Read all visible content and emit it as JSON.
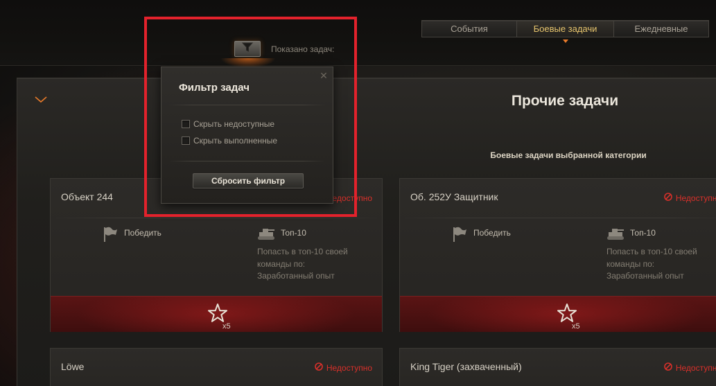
{
  "tabs": [
    {
      "label": "События",
      "active": false
    },
    {
      "label": "Боевые задачи",
      "active": true
    },
    {
      "label": "Ежедневные",
      "active": false
    }
  ],
  "filter_bar": {
    "toggle_icon": "funnel-icon",
    "shown_label": "Показано задач:"
  },
  "section": {
    "title": "Прочие задачи",
    "caption": "Боевые задачи выбранной категории"
  },
  "popup": {
    "title": "Фильтр задач",
    "options": [
      {
        "label": "Скрыть недоступные",
        "checked": false
      },
      {
        "label": "Скрыть выполненные",
        "checked": false
      }
    ],
    "reset_label": "Сбросить фильтр"
  },
  "cards": [
    {
      "title": "Объект 244",
      "status": "Недоступно",
      "condition1": {
        "label": "Победить",
        "icon": "flag-icon"
      },
      "condition2": {
        "label": "Топ-10",
        "icon": "tank-icon",
        "desc": "Попасть в топ-10 своей команды по: Заработанный опыт"
      },
      "reward_count": "x5"
    },
    {
      "title": "Об. 252У Защитник",
      "status": "Недоступно",
      "condition1": {
        "label": "Победить",
        "icon": "flag-icon"
      },
      "condition2": {
        "label": "Топ-10",
        "icon": "tank-icon",
        "desc": "Попасть в топ-10 своей команды по: Заработанный опыт"
      },
      "reward_count": "x5"
    },
    {
      "title": "Löwe",
      "status": "Недоступно"
    },
    {
      "title": "King Tiger (захваченный)",
      "status": "Недоступно"
    }
  ],
  "colors": {
    "accent": "#e6c46d",
    "unavailable": "#d9302a",
    "highlight": "#e3222c",
    "reward_bg": "#5a1414"
  }
}
